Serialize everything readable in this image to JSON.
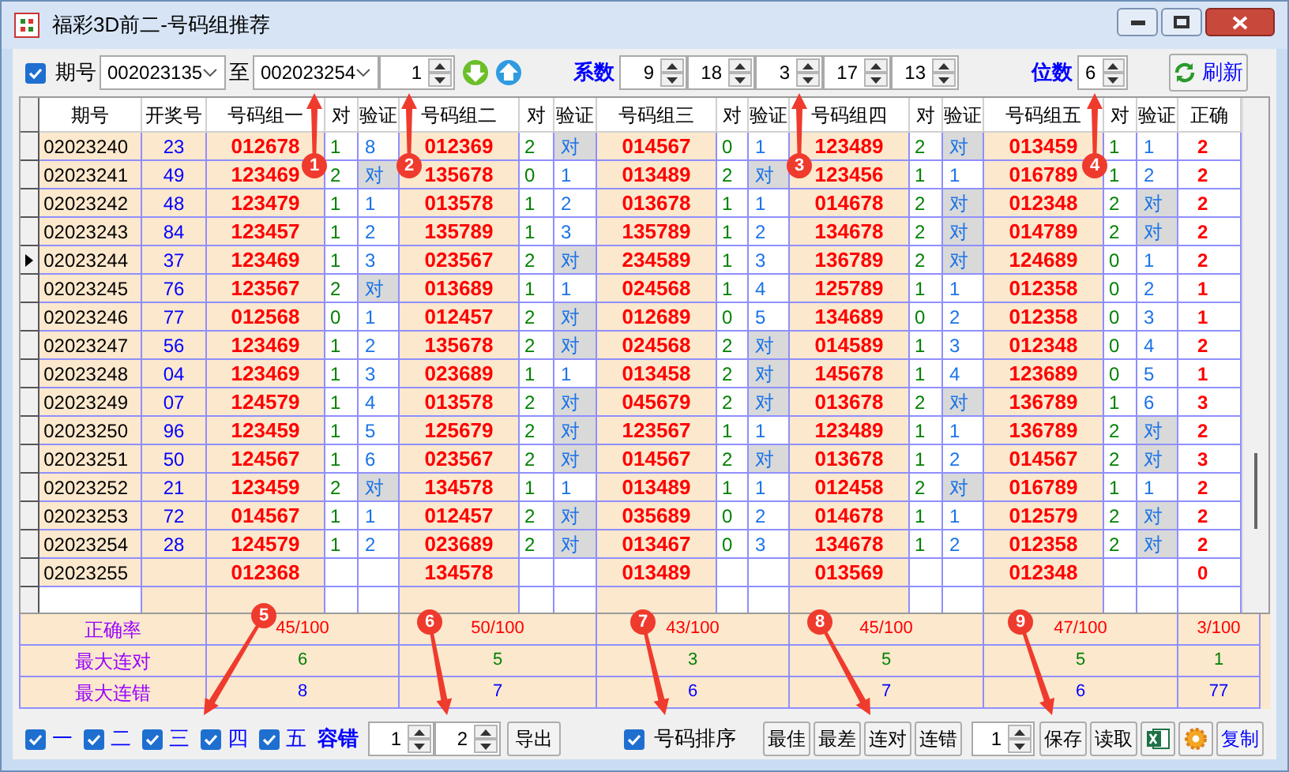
{
  "window": {
    "title": "福彩3D前二-号码组推荐"
  },
  "toolbar": {
    "issue": {
      "label": "期号",
      "checked": true
    },
    "from_issue": "002023135",
    "to_label": "至",
    "to_issue": "002023254",
    "step": "1",
    "coefficient_label": "系数",
    "coefficients": [
      "9",
      "18",
      "3",
      "17",
      "13"
    ],
    "digits_label": "位数",
    "digits": "6",
    "refresh": "刷新"
  },
  "table": {
    "columns": [
      "期号",
      "开奖号",
      "号码组一",
      "对",
      "验证",
      "号码组二",
      "对",
      "验证",
      "号码组三",
      "对",
      "验证",
      "号码组四",
      "对",
      "验证",
      "号码组五",
      "对",
      "验证",
      "正确"
    ],
    "rows": [
      {
        "issue": "02023240",
        "draw": "23",
        "current": false,
        "groups": [
          {
            "numbers": "012678",
            "hits": "1",
            "verify": "8",
            "hit": false
          },
          {
            "numbers": "012369",
            "hits": "2",
            "verify": "对",
            "hit": true
          },
          {
            "numbers": "014567",
            "hits": "0",
            "verify": "1",
            "hit": false
          },
          {
            "numbers": "123489",
            "hits": "2",
            "verify": "对",
            "hit": true
          },
          {
            "numbers": "013459",
            "hits": "1",
            "verify": "1",
            "hit": false
          }
        ],
        "correct": "2"
      },
      {
        "issue": "02023241",
        "draw": "49",
        "current": false,
        "groups": [
          {
            "numbers": "123469",
            "hits": "2",
            "verify": "对",
            "hit": true
          },
          {
            "numbers": "135678",
            "hits": "0",
            "verify": "1",
            "hit": false
          },
          {
            "numbers": "013489",
            "hits": "2",
            "verify": "对",
            "hit": true
          },
          {
            "numbers": "123456",
            "hits": "1",
            "verify": "1",
            "hit": false
          },
          {
            "numbers": "016789",
            "hits": "1",
            "verify": "2",
            "hit": false
          }
        ],
        "correct": "2"
      },
      {
        "issue": "02023242",
        "draw": "48",
        "current": false,
        "groups": [
          {
            "numbers": "123479",
            "hits": "1",
            "verify": "1",
            "hit": false
          },
          {
            "numbers": "013578",
            "hits": "1",
            "verify": "2",
            "hit": false
          },
          {
            "numbers": "013678",
            "hits": "1",
            "verify": "1",
            "hit": false
          },
          {
            "numbers": "014678",
            "hits": "2",
            "verify": "对",
            "hit": true
          },
          {
            "numbers": "012348",
            "hits": "2",
            "verify": "对",
            "hit": true
          }
        ],
        "correct": "2"
      },
      {
        "issue": "02023243",
        "draw": "84",
        "current": false,
        "groups": [
          {
            "numbers": "123457",
            "hits": "1",
            "verify": "2",
            "hit": false
          },
          {
            "numbers": "135789",
            "hits": "1",
            "verify": "3",
            "hit": false
          },
          {
            "numbers": "135789",
            "hits": "1",
            "verify": "2",
            "hit": false
          },
          {
            "numbers": "134678",
            "hits": "2",
            "verify": "对",
            "hit": true
          },
          {
            "numbers": "014789",
            "hits": "2",
            "verify": "对",
            "hit": true
          }
        ],
        "correct": "2"
      },
      {
        "issue": "02023244",
        "draw": "37",
        "current": true,
        "groups": [
          {
            "numbers": "123469",
            "hits": "1",
            "verify": "3",
            "hit": false
          },
          {
            "numbers": "023567",
            "hits": "2",
            "verify": "对",
            "hit": true
          },
          {
            "numbers": "234589",
            "hits": "1",
            "verify": "3",
            "hit": false
          },
          {
            "numbers": "136789",
            "hits": "2",
            "verify": "对",
            "hit": true
          },
          {
            "numbers": "124689",
            "hits": "0",
            "verify": "1",
            "hit": false
          }
        ],
        "correct": "2"
      },
      {
        "issue": "02023245",
        "draw": "76",
        "current": false,
        "groups": [
          {
            "numbers": "123567",
            "hits": "2",
            "verify": "对",
            "hit": true
          },
          {
            "numbers": "013689",
            "hits": "1",
            "verify": "1",
            "hit": false
          },
          {
            "numbers": "024568",
            "hits": "1",
            "verify": "4",
            "hit": false
          },
          {
            "numbers": "125789",
            "hits": "1",
            "verify": "1",
            "hit": false
          },
          {
            "numbers": "012358",
            "hits": "0",
            "verify": "2",
            "hit": false
          }
        ],
        "correct": "1"
      },
      {
        "issue": "02023246",
        "draw": "77",
        "current": false,
        "groups": [
          {
            "numbers": "012568",
            "hits": "0",
            "verify": "1",
            "hit": false
          },
          {
            "numbers": "012457",
            "hits": "2",
            "verify": "对",
            "hit": true
          },
          {
            "numbers": "012689",
            "hits": "0",
            "verify": "5",
            "hit": false
          },
          {
            "numbers": "134689",
            "hits": "0",
            "verify": "2",
            "hit": false
          },
          {
            "numbers": "012358",
            "hits": "0",
            "verify": "3",
            "hit": false
          }
        ],
        "correct": "1"
      },
      {
        "issue": "02023247",
        "draw": "56",
        "current": false,
        "groups": [
          {
            "numbers": "123469",
            "hits": "1",
            "verify": "2",
            "hit": false
          },
          {
            "numbers": "135678",
            "hits": "2",
            "verify": "对",
            "hit": true
          },
          {
            "numbers": "024568",
            "hits": "2",
            "verify": "对",
            "hit": true
          },
          {
            "numbers": "014589",
            "hits": "1",
            "verify": "3",
            "hit": false
          },
          {
            "numbers": "012348",
            "hits": "0",
            "verify": "4",
            "hit": false
          }
        ],
        "correct": "2"
      },
      {
        "issue": "02023248",
        "draw": "04",
        "current": false,
        "groups": [
          {
            "numbers": "123469",
            "hits": "1",
            "verify": "3",
            "hit": false
          },
          {
            "numbers": "023689",
            "hits": "1",
            "verify": "1",
            "hit": false
          },
          {
            "numbers": "013458",
            "hits": "2",
            "verify": "对",
            "hit": true
          },
          {
            "numbers": "145678",
            "hits": "1",
            "verify": "4",
            "hit": false
          },
          {
            "numbers": "123689",
            "hits": "0",
            "verify": "5",
            "hit": false
          }
        ],
        "correct": "1"
      },
      {
        "issue": "02023249",
        "draw": "07",
        "current": false,
        "groups": [
          {
            "numbers": "124579",
            "hits": "1",
            "verify": "4",
            "hit": false
          },
          {
            "numbers": "013578",
            "hits": "2",
            "verify": "对",
            "hit": true
          },
          {
            "numbers": "045679",
            "hits": "2",
            "verify": "对",
            "hit": true
          },
          {
            "numbers": "013678",
            "hits": "2",
            "verify": "对",
            "hit": true
          },
          {
            "numbers": "136789",
            "hits": "1",
            "verify": "6",
            "hit": false
          }
        ],
        "correct": "3"
      },
      {
        "issue": "02023250",
        "draw": "96",
        "current": false,
        "groups": [
          {
            "numbers": "123459",
            "hits": "1",
            "verify": "5",
            "hit": false
          },
          {
            "numbers": "125679",
            "hits": "2",
            "verify": "对",
            "hit": true
          },
          {
            "numbers": "123567",
            "hits": "1",
            "verify": "1",
            "hit": false
          },
          {
            "numbers": "123489",
            "hits": "1",
            "verify": "1",
            "hit": false
          },
          {
            "numbers": "136789",
            "hits": "2",
            "verify": "对",
            "hit": true
          }
        ],
        "correct": "2"
      },
      {
        "issue": "02023251",
        "draw": "50",
        "current": false,
        "groups": [
          {
            "numbers": "124567",
            "hits": "1",
            "verify": "6",
            "hit": false
          },
          {
            "numbers": "023567",
            "hits": "2",
            "verify": "对",
            "hit": true
          },
          {
            "numbers": "014567",
            "hits": "2",
            "verify": "对",
            "hit": true
          },
          {
            "numbers": "013678",
            "hits": "1",
            "verify": "2",
            "hit": false
          },
          {
            "numbers": "014567",
            "hits": "2",
            "verify": "对",
            "hit": true
          }
        ],
        "correct": "3"
      },
      {
        "issue": "02023252",
        "draw": "21",
        "current": false,
        "groups": [
          {
            "numbers": "123459",
            "hits": "2",
            "verify": "对",
            "hit": true
          },
          {
            "numbers": "134578",
            "hits": "1",
            "verify": "1",
            "hit": false
          },
          {
            "numbers": "013489",
            "hits": "1",
            "verify": "1",
            "hit": false
          },
          {
            "numbers": "012458",
            "hits": "2",
            "verify": "对",
            "hit": true
          },
          {
            "numbers": "016789",
            "hits": "1",
            "verify": "1",
            "hit": false
          }
        ],
        "correct": "2"
      },
      {
        "issue": "02023253",
        "draw": "72",
        "current": false,
        "groups": [
          {
            "numbers": "014567",
            "hits": "1",
            "verify": "1",
            "hit": false
          },
          {
            "numbers": "012457",
            "hits": "2",
            "verify": "对",
            "hit": true
          },
          {
            "numbers": "035689",
            "hits": "0",
            "verify": "2",
            "hit": false
          },
          {
            "numbers": "014678",
            "hits": "1",
            "verify": "1",
            "hit": false
          },
          {
            "numbers": "012579",
            "hits": "2",
            "verify": "对",
            "hit": true
          }
        ],
        "correct": "2"
      },
      {
        "issue": "02023254",
        "draw": "28",
        "current": false,
        "groups": [
          {
            "numbers": "124579",
            "hits": "1",
            "verify": "2",
            "hit": false
          },
          {
            "numbers": "023689",
            "hits": "2",
            "verify": "对",
            "hit": true
          },
          {
            "numbers": "013467",
            "hits": "0",
            "verify": "3",
            "hit": false
          },
          {
            "numbers": "134678",
            "hits": "1",
            "verify": "2",
            "hit": false
          },
          {
            "numbers": "012358",
            "hits": "2",
            "verify": "对",
            "hit": true
          }
        ],
        "correct": "2"
      },
      {
        "issue": "02023255",
        "current": false,
        "groups": [
          {
            "numbers": "012368"
          },
          {
            "numbers": "134578"
          },
          {
            "numbers": "013489"
          },
          {
            "numbers": "013569"
          },
          {
            "numbers": "012348"
          }
        ],
        "correct": "0"
      }
    ]
  },
  "summary": [
    {
      "label": "正确率",
      "kind": "rate",
      "values": [
        "45/100",
        "50/100",
        "43/100",
        "45/100",
        "47/100",
        "3/100"
      ]
    },
    {
      "label": "最大连对",
      "kind": "max_hit",
      "values": [
        "6",
        "5",
        "3",
        "5",
        "5",
        "1"
      ]
    },
    {
      "label": "最大连错",
      "kind": "max_miss",
      "values": [
        "8",
        "7",
        "6",
        "7",
        "6",
        "77"
      ]
    }
  ],
  "bottom": {
    "groups": [
      {
        "label": "一",
        "checked": true
      },
      {
        "label": "二",
        "checked": true
      },
      {
        "label": "三",
        "checked": true
      },
      {
        "label": "四",
        "checked": true
      },
      {
        "label": "五",
        "checked": true
      }
    ],
    "tolerance_label": "容错",
    "tolerance": [
      "1",
      "2"
    ],
    "export": "导出",
    "sort": {
      "label": "号码排序",
      "checked": true
    },
    "buttons": [
      "最佳",
      "最差",
      "连对",
      "连错"
    ],
    "count": "1",
    "save": "保存",
    "read": "读取",
    "copy": "复制"
  },
  "annotations": [
    {
      "label": "1"
    },
    {
      "label": "2"
    },
    {
      "label": "3"
    },
    {
      "label": "4"
    },
    {
      "label": "5"
    },
    {
      "label": "6"
    },
    {
      "label": "7"
    },
    {
      "label": "8"
    },
    {
      "label": "9"
    }
  ]
}
